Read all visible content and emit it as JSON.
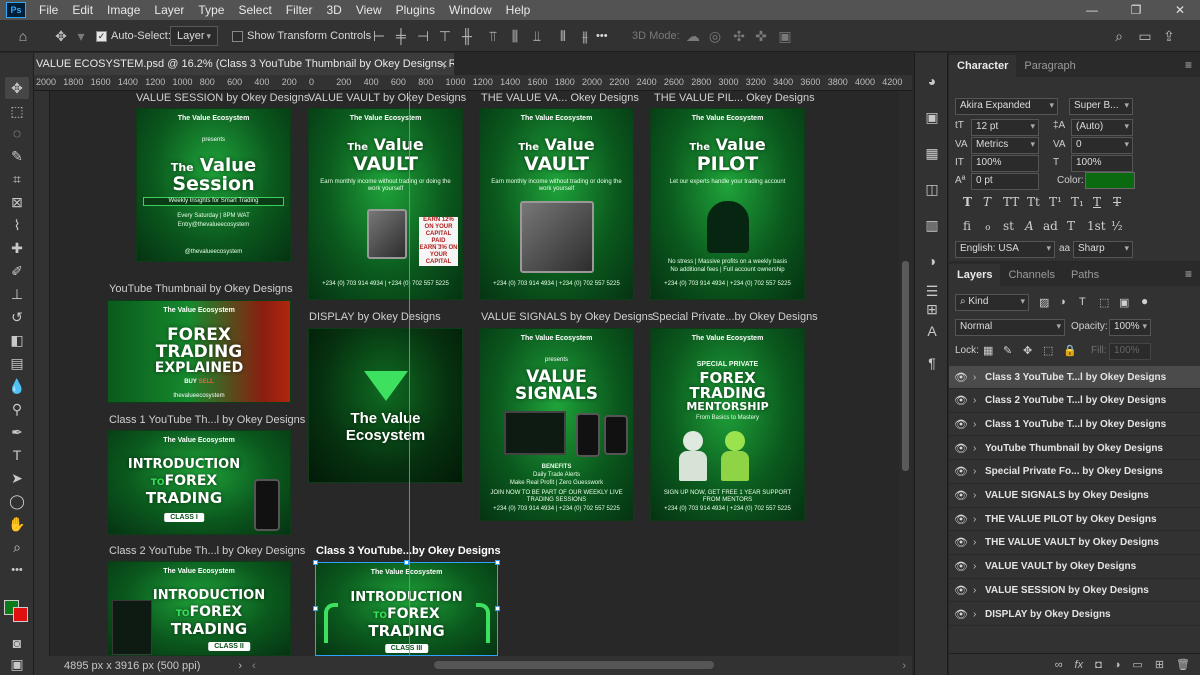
{
  "menu": [
    "File",
    "Edit",
    "Image",
    "Layer",
    "Type",
    "Select",
    "Filter",
    "3D",
    "View",
    "Plugins",
    "Window",
    "Help"
  ],
  "window_controls": [
    "—",
    "❐",
    "✕"
  ],
  "options": {
    "auto_select_label": "Auto-Select:",
    "auto_select_checked": true,
    "auto_select_target": "Layer",
    "show_transform_label": "Show Transform Controls",
    "show_transform_checked": false,
    "mode_3d_label": "3D Mode:",
    "more_label": "•••"
  },
  "document": {
    "tab_title": "VALUE ECOSYSTEM.psd @ 16.2% (Class 3 YouTube Thumbnail by Okey Designs, RGB/8) *",
    "ruler_ticks": [
      "2000",
      "1800",
      "1600",
      "1400",
      "1200",
      "1000",
      "800",
      "600",
      "400",
      "200",
      "0",
      "200",
      "400",
      "600",
      "800",
      "1000",
      "1200",
      "1400",
      "1600",
      "1800",
      "2000",
      "2200",
      "2400",
      "2600",
      "2800",
      "3000",
      "3200",
      "3400",
      "3600",
      "3800",
      "4000",
      "4200"
    ],
    "status": "4895 px x 3916 px (500 ppi)",
    "status_arrow": "›"
  },
  "artboards": {
    "value_session": {
      "label": "VALUE SESSION by Okey Designs",
      "brand": "The Value Ecosystem",
      "presents": "presents",
      "title_small": "The",
      "title_a": "Value",
      "title_b": "Session",
      "subtitle": "Weekly Insights for Smart Trading",
      "schedule": "Every Saturday | 8PM WAT",
      "email": "Entry@thevalueecosystem",
      "handle": "@thevalueecosystem"
    },
    "value_vault_1": {
      "label": "VALUE VAULT by Okey Designs",
      "title_small": "The",
      "title_a": "Value",
      "title_b": "VAULT",
      "subtitle": "Earn monthly income without trading or doing the work yourself",
      "offer": "EARN 12% ON YOUR CAPITAL PAID MONTHLY",
      "offer2": "EARN 3% ON YOUR CAPITAL",
      "phones": "+234 (0) 703 914 4934 | +234 (0) 702 557 5225"
    },
    "the_value_vault": {
      "label": "THE VALUE VA... Okey Designs",
      "title_small": "The",
      "title_a": "Value",
      "title_b": "VAULT",
      "subtitle": "Earn monthly income without trading or doing the work yourself",
      "phones": "+234 (0) 703 914 4934 | +234 (0) 702 557 5225"
    },
    "the_value_pilot": {
      "label": "THE VALUE PIL... Okey Designs",
      "title_small": "The",
      "title_a": "Value",
      "title_b": "PILOT",
      "subtitle": "Let our experts handle your trading account",
      "bottom": "No stress | Massive profits on a weekly basis",
      "bottom2": "No additional fees | Full account ownership",
      "phones": "+234 (0) 703 914 4934 | +234 (0) 702 557 5225"
    },
    "youtube_thumb": {
      "label": "YouTube Thumbnail by Okey Designs",
      "line1": "FOREX",
      "line2": "TRADING",
      "line3": "EXPLAINED",
      "buy": "BUY",
      "sell": "SELL",
      "handle": "thevalueecosystem"
    },
    "display": {
      "label": "DISPLAY by Okey Designs",
      "line1": "The Value",
      "line2": "Ecosystem"
    },
    "value_signals": {
      "label": "VALUE SIGNALS by Okey Designs",
      "presents": "presents",
      "title_a": "VALUE",
      "title_b": "SIGNALS",
      "benefits": "BENEFITS",
      "benefit1": "Daily Trade Alerts",
      "benefit2": "Make Real Profit | Zero Guesswork",
      "cta": "JOIN NOW TO BE PART OF OUR WEEKLY LIVE TRADING SESSIONS",
      "phones": "+234 (0) 703 914 4934 | +234 (0) 702 557 5225"
    },
    "special_private": {
      "label": "Special Private...by Okey Designs",
      "line1": "SPECIAL PRIVATE",
      "line2": "FOREX",
      "line3": "TRADING",
      "line4": "MENTORSHIP",
      "line5": "From Basics to Mastery",
      "cta": "SIGN UP NOW, GET FREE 1 YEAR SUPPORT FROM MENTORS",
      "phones": "+234 (0) 703 914 4934 | +234 (0) 702 557 5225"
    },
    "class1": {
      "label": "Class 1 YouTube Th...l by Okey Designs",
      "line1": "INTRODUCTION",
      "to": "TO",
      "line2": "FOREX",
      "line3": "TRADING",
      "badge": "CLASS I"
    },
    "class2": {
      "label": "Class 2 YouTube Th...l by Okey Designs",
      "line1": "INTRODUCTION",
      "to": "TO",
      "line2": "FOREX",
      "line3": "TRADING",
      "badge": "CLASS II"
    },
    "class3": {
      "label": "Class 3 YouTube...by Okey Designs",
      "line1": "INTRODUCTION",
      "to": "TO",
      "line2": "FOREX",
      "line3": "TRADING",
      "badge": "CLASS III"
    },
    "brand_mini": "The Value Ecosystem"
  },
  "character_panel": {
    "tabs": [
      "Character",
      "Paragraph"
    ],
    "font_family": "Akira Expanded",
    "font_style": "Super B...",
    "size": "12 pt",
    "leading": "(Auto)",
    "kerning": "Metrics",
    "tracking": "0",
    "vscale": "100%",
    "hscale": "100%",
    "baseline": "0 pt",
    "color_label": "Color:",
    "text_color": "#0a6a10",
    "glyphs": [
      "T",
      "T",
      "TT",
      "Tt",
      "T¹",
      "T₁",
      "T",
      "T"
    ],
    "glyphs2": [
      "fi",
      "ℴ",
      "st",
      "A",
      "ad",
      "T",
      "1st",
      "½"
    ],
    "language": "English: USA",
    "aa_label": "aa",
    "antialias": "Sharp"
  },
  "layers_panel": {
    "tabs": [
      "Layers",
      "Channels",
      "Paths"
    ],
    "filter_kind": "Kind",
    "blend_mode": "Normal",
    "opacity_label": "Opacity:",
    "opacity": "100%",
    "lock_label": "Lock:",
    "fill_label": "Fill:",
    "fill": "100%",
    "layers": [
      {
        "name": "Class 3 YouTube T...l by Okey Designs",
        "selected": true
      },
      {
        "name": "Class 2 YouTube T...l by Okey Designs",
        "selected": false
      },
      {
        "name": "Class 1 YouTube T...l by Okey Designs",
        "selected": false
      },
      {
        "name": "YouTube Thumbnail by Okey Designs",
        "selected": false
      },
      {
        "name": "Special Private Fo... by Okey Designs",
        "selected": false
      },
      {
        "name": "VALUE SIGNALS  by Okey Designs",
        "selected": false
      },
      {
        "name": " THE VALUE PILOT by Okey Designs",
        "selected": false
      },
      {
        "name": " THE VALUE VAULT by Okey Designs",
        "selected": false
      },
      {
        "name": "VALUE VAULT by Okey Designs",
        "selected": false
      },
      {
        "name": "VALUE SESSION by Okey Designs",
        "selected": false
      },
      {
        "name": "DISPLAY by Okey Designs",
        "selected": false
      }
    ],
    "footer_icons": [
      "link-icon",
      "fx-icon",
      "mask-icon",
      "adjustment-icon",
      "folder-icon",
      "new-layer-icon",
      "trash-icon"
    ]
  },
  "colors": {
    "foreground": "#0a7a1a",
    "background": "#e01010",
    "accent_green": "#38e25a",
    "selection_blue": "#2ea3ff",
    "guide_cyan": "#29b6d6"
  }
}
